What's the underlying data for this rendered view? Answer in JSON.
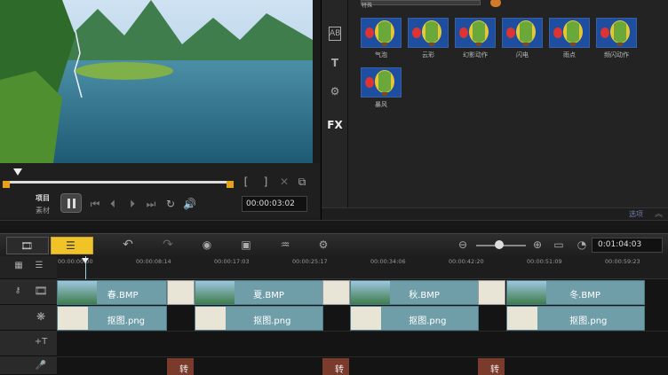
{
  "preview": {
    "project_label": "项目",
    "clip_label": "素材",
    "timecode": "00:00:03:02",
    "bracket_in": "[",
    "bracket_out": "]"
  },
  "library": {
    "category": "特殊",
    "options_label": "选项",
    "fx_tab": "FX",
    "text_tab": "T",
    "effects": [
      "气泡",
      "云彩",
      "幻影动作",
      "闪电",
      "雨点",
      "频闪动作",
      "暴风"
    ]
  },
  "timeline": {
    "timecode": "0:01:04:03",
    "ruler": [
      "00:00:00:00",
      "00:00:08:14",
      "00:00:17:03",
      "00:00:25:17",
      "00:00:34:06",
      "00:00:42:20",
      "00:00:51:09",
      "00:00:59:23"
    ],
    "video_clips": [
      "春.BMP",
      "夏.BMP",
      "秋.BMP",
      "冬.BMP"
    ],
    "overlay_clips": [
      "抠图.png",
      "抠图.png",
      "抠图.png",
      "抠图.png"
    ],
    "transition_label": "转场"
  },
  "colors": {
    "accent": "#e8a21a",
    "clip": "#6f9ea9",
    "toolbar_active": "#f0c428"
  }
}
